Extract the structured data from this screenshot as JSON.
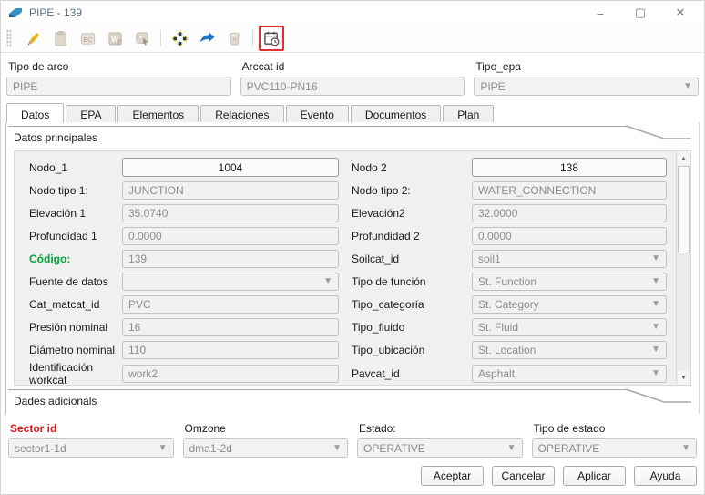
{
  "window": {
    "title": "PIPE - 139",
    "controls": {
      "minimize": "–",
      "maximize": "▢",
      "close": "✕"
    }
  },
  "toolbar": {
    "icons": [
      {
        "name": "edit-pencil",
        "enabled": true
      },
      {
        "name": "paste-clipboard",
        "enabled": false
      },
      {
        "name": "ec-document",
        "enabled": false
      },
      {
        "name": "word-document",
        "enabled": false
      },
      {
        "name": "image-select",
        "enabled": false
      },
      {
        "name": "move-arrows",
        "enabled": true
      },
      {
        "name": "forward-arrow",
        "enabled": true
      },
      {
        "name": "trash",
        "enabled": false
      },
      {
        "name": "calendar-clock",
        "enabled": true,
        "highlighted": true
      }
    ],
    "highlight_color": "#e0312f"
  },
  "top_form": {
    "fields": [
      {
        "label": "Tipo de arco",
        "value": "PIPE",
        "type": "input"
      },
      {
        "label": "Arccat id",
        "value": "PVC110-PN16",
        "type": "input"
      },
      {
        "label": "Tipo_epa",
        "value": "PIPE",
        "type": "select"
      }
    ]
  },
  "tabs": [
    {
      "label": "Datos",
      "active": true
    },
    {
      "label": "EPA",
      "active": false
    },
    {
      "label": "Elementos",
      "active": false
    },
    {
      "label": "Relaciones",
      "active": false
    },
    {
      "label": "Evento",
      "active": false
    },
    {
      "label": "Documentos",
      "active": false
    },
    {
      "label": "Plan",
      "active": false
    }
  ],
  "sections": {
    "main": "Datos principales",
    "additional": "Dades adicionals"
  },
  "form": {
    "rows": [
      {
        "left": {
          "label": "Nodo_1",
          "value": "1004",
          "type": "button"
        },
        "right": {
          "label": "Nodo 2",
          "value": "138",
          "type": "button"
        }
      },
      {
        "left": {
          "label": "Nodo tipo 1:",
          "value": "JUNCTION",
          "type": "input"
        },
        "right": {
          "label": "Nodo tipo 2:",
          "value": "WATER_CONNECTION",
          "type": "input"
        }
      },
      {
        "left": {
          "label": "Elevación 1",
          "value": "35.0740",
          "type": "input"
        },
        "right": {
          "label": "Elevación2",
          "value": "32.0000",
          "type": "input"
        }
      },
      {
        "left": {
          "label": "Profundidad 1",
          "value": "0.0000",
          "type": "input"
        },
        "right": {
          "label": "Profundidad 2",
          "value": "0.0000",
          "type": "input"
        }
      },
      {
        "left": {
          "label": "Código:",
          "value": "139",
          "type": "input",
          "label_color": "#00a33a"
        },
        "right": {
          "label": "Soilcat_id",
          "value": "soil1",
          "type": "select"
        }
      },
      {
        "left": {
          "label": "Fuente de datos",
          "value": "",
          "type": "select"
        },
        "right": {
          "label": "Tipo de función",
          "value": "St. Function",
          "type": "select"
        }
      },
      {
        "left": {
          "label": "Cat_matcat_id",
          "value": "PVC",
          "type": "input"
        },
        "right": {
          "label": "Tipo_categoría",
          "value": "St. Category",
          "type": "select"
        }
      },
      {
        "left": {
          "label": "Presión nominal",
          "value": "16",
          "type": "input"
        },
        "right": {
          "label": "Tipo_fluido",
          "value": "St. Fluid",
          "type": "select"
        }
      },
      {
        "left": {
          "label": "Diámetro nominal",
          "value": "110",
          "type": "input"
        },
        "right": {
          "label": "Tipo_ubicación",
          "value": "St. Location",
          "type": "select"
        }
      },
      {
        "left": {
          "label": "Identificación workcat",
          "value": "work2",
          "type": "input"
        },
        "right": {
          "label": "Pavcat_id",
          "value": "Asphalt",
          "type": "select"
        }
      }
    ]
  },
  "bottom_form": {
    "fields": [
      {
        "label": "Sector id",
        "value": "sector1-1d",
        "label_color": "#e01b1b"
      },
      {
        "label": "Omzone",
        "value": "dma1-2d"
      },
      {
        "label": "Estado:",
        "value": "OPERATIVE"
      },
      {
        "label": "Tipo de estado",
        "value": "OPERATIVE"
      }
    ]
  },
  "buttons": [
    "Aceptar",
    "Cancelar",
    "Aplicar",
    "Ayuda"
  ],
  "colors": {
    "code_green": "#00a33a",
    "sector_red": "#e01b1b",
    "highlight_red": "#e0312f"
  }
}
